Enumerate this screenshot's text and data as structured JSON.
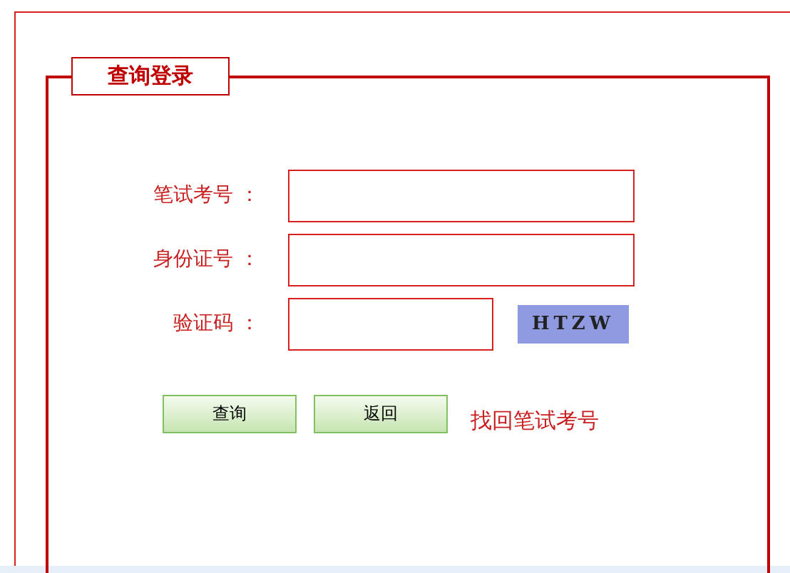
{
  "legend": "查询登录",
  "fields": [
    {
      "kind": "text",
      "label": "笔试考号 ："
    },
    {
      "kind": "text",
      "label": "身份证号 ："
    },
    {
      "kind": "captcha",
      "label": "验证码 ：",
      "captcha": "HTZW"
    }
  ],
  "buttons": [
    "查询",
    "返回"
  ],
  "link": "找回笔试考号"
}
